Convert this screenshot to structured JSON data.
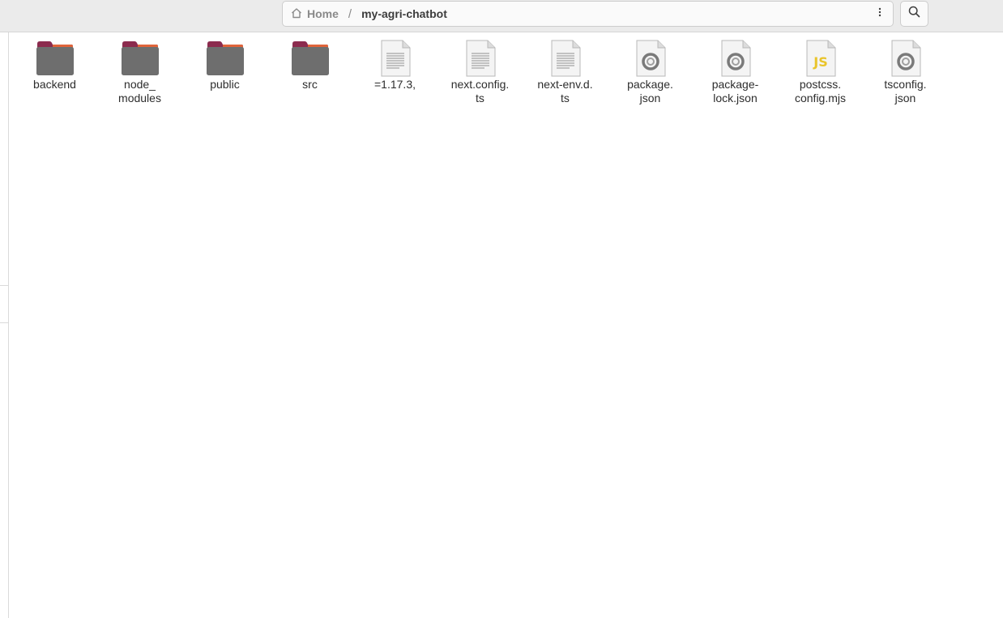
{
  "pathbar": {
    "home_label": "Home",
    "separator": "/",
    "current_folder": "my-agri-chatbot"
  },
  "icons": {
    "home": "home-icon",
    "menu": "vertical-dots-icon",
    "search": "search-icon"
  },
  "files": [
    {
      "line1": "backend",
      "line2": "",
      "type": "folder"
    },
    {
      "line1": "node_",
      "line2": "modules",
      "type": "folder"
    },
    {
      "line1": "public",
      "line2": "",
      "type": "folder"
    },
    {
      "line1": "src",
      "line2": "",
      "type": "folder"
    },
    {
      "line1": "=1.17.3,",
      "line2": "",
      "type": "text"
    },
    {
      "line1": "next.config.",
      "line2": "ts",
      "type": "text"
    },
    {
      "line1": "next-env.d.",
      "line2": "ts",
      "type": "text"
    },
    {
      "line1": "package.",
      "line2": "json",
      "type": "json"
    },
    {
      "line1": "package-",
      "line2": "lock.json",
      "type": "json"
    },
    {
      "line1": "postcss.",
      "line2": "config.mjs",
      "type": "javascript",
      "badge": "JS"
    },
    {
      "line1": "tsconfig.",
      "line2": "json",
      "type": "json"
    }
  ],
  "colors": {
    "folder_body": "#6e6e6e",
    "folder_tab": "#8c2b4e",
    "folder_accent": "#e0643a",
    "js_badge": "#e9c42b"
  }
}
